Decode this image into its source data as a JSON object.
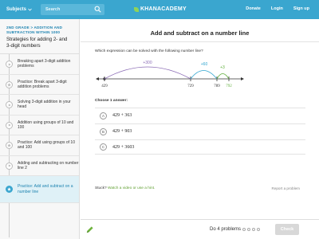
{
  "header": {
    "subjects_label": "Subjects",
    "search_label": "Search",
    "logo_prefix": "",
    "logo_text": "KHANACADEMY",
    "nav": [
      "Donate",
      "Login",
      "Sign up"
    ]
  },
  "sidebar": {
    "breadcrumb": "2ND GRADE > ADDITION AND SUBTRACTION WITHIN 1000",
    "title": "Strategies for adding 2- and 3-digit numbers",
    "items": [
      {
        "label": "Breaking apart 3-digit addition problems",
        "icon": "play-icon"
      },
      {
        "label": "Practice: Break apart 3-digit addition problems",
        "icon": "star-icon"
      },
      {
        "label": "Solving 3-digit addition in your head",
        "icon": "play-icon"
      },
      {
        "label": "Addition using groups of 10 and 100",
        "icon": "play-icon"
      },
      {
        "label": "Practice: Add using groups of 10 and 100",
        "icon": "star-icon"
      },
      {
        "label": "Adding and subtracting on number line 2",
        "icon": "play-icon"
      },
      {
        "label": "Practice: Add and subtract on a number line",
        "icon": "star-icon",
        "active": true
      }
    ]
  },
  "exercise": {
    "title": "Add and subtract on a number line",
    "question": "Which expression can be solved with the following number line?",
    "numberline": {
      "start": "429",
      "mid1": "729",
      "mid2": "789",
      "end": "792",
      "jump1": "+300",
      "jump2": "+60",
      "jump3": "+3"
    },
    "choose_label": "Choose 1 answer:",
    "choices": [
      {
        "letter": "A",
        "text": "429 + 363"
      },
      {
        "letter": "B",
        "text": "429 + 903"
      },
      {
        "letter": "C",
        "text": "429 + 3603"
      }
    ],
    "stuck_label": "Stuck?",
    "stuck_link": "Watch a video or use a hint.",
    "report": "Report a problem"
  },
  "footer": {
    "progress_text": "Do 4 problems",
    "check_label": "Check"
  },
  "colors": {
    "topbar": "#3aa6cf",
    "jump1": "#8a6bb5",
    "jump2": "#2fa4cf",
    "jump3": "#5fae3a"
  }
}
